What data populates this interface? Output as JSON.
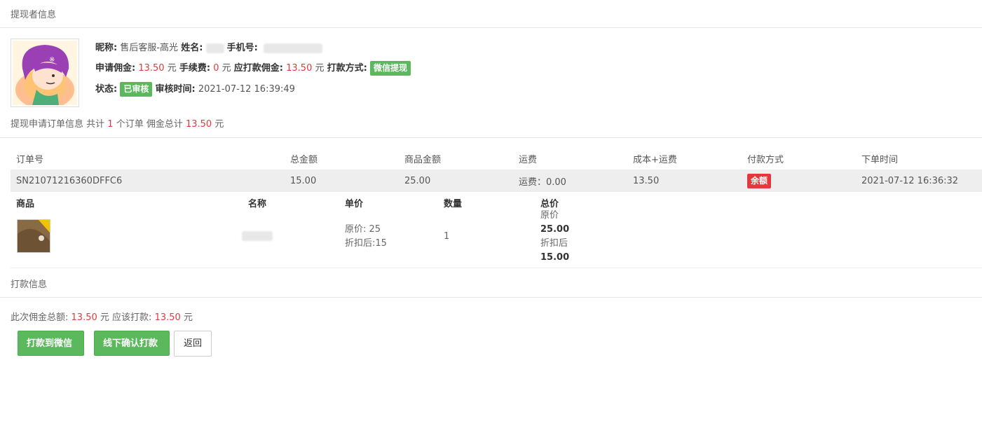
{
  "sections": {
    "withdrawer_title": "提现者信息",
    "payment_title": "打款信息"
  },
  "user": {
    "nickname_label": "昵称:",
    "nickname": "售后客服-高光",
    "name_label": "姓名:",
    "phone_label": "手机号:",
    "apply_label": "申请佣金:",
    "apply_amount": "13.50",
    "fee_label": "手续费:",
    "fee_amount": "0",
    "payable_label": "应打款佣金:",
    "payable_amount": "13.50",
    "yuan": "元",
    "method_label": "打款方式:",
    "method_badge": "微信提现",
    "status_label": "状态:",
    "status_badge": "已审核",
    "review_label": "审核时间:",
    "review_time": "2021-07-12 16:39:49"
  },
  "summary": {
    "prefix": "提现申请订单信息 共计",
    "order_count": "1",
    "middle": "个订单 佣金总计",
    "total": "13.50",
    "suffix": "元"
  },
  "orders": {
    "headers": [
      "订单号",
      "总金额",
      "商品金额",
      "运费",
      "成本+运费",
      "付款方式",
      "下单时间"
    ],
    "row": {
      "order_no": "SN21071216360DFFC6",
      "total": "15.00",
      "goods_amount": "25.00",
      "freight": "运费：0.00",
      "cost_freight": "13.50",
      "pay_method": "余额",
      "order_time": "2021-07-12 16:36:32"
    }
  },
  "goods": {
    "headers": [
      "商品",
      "名称",
      "单价",
      "数量",
      "总价"
    ],
    "price_original": "原价: 25",
    "price_discount": "折扣后:15",
    "quantity": "1",
    "total_original_label": "原价",
    "total_original": "25.00",
    "total_discount_label": "折扣后",
    "total_discount": "15.00"
  },
  "payment": {
    "total_label": "此次佣金总额:",
    "total": "13.50",
    "yuan": "元",
    "should_label": "应该打款:",
    "should": "13.50"
  },
  "buttons": {
    "pay_wechat": "打款到微信",
    "offline_confirm": "线下确认打款",
    "back": "返回"
  },
  "colors": {
    "accent_green": "#5cb85c",
    "accent_red": "#e4393c"
  }
}
